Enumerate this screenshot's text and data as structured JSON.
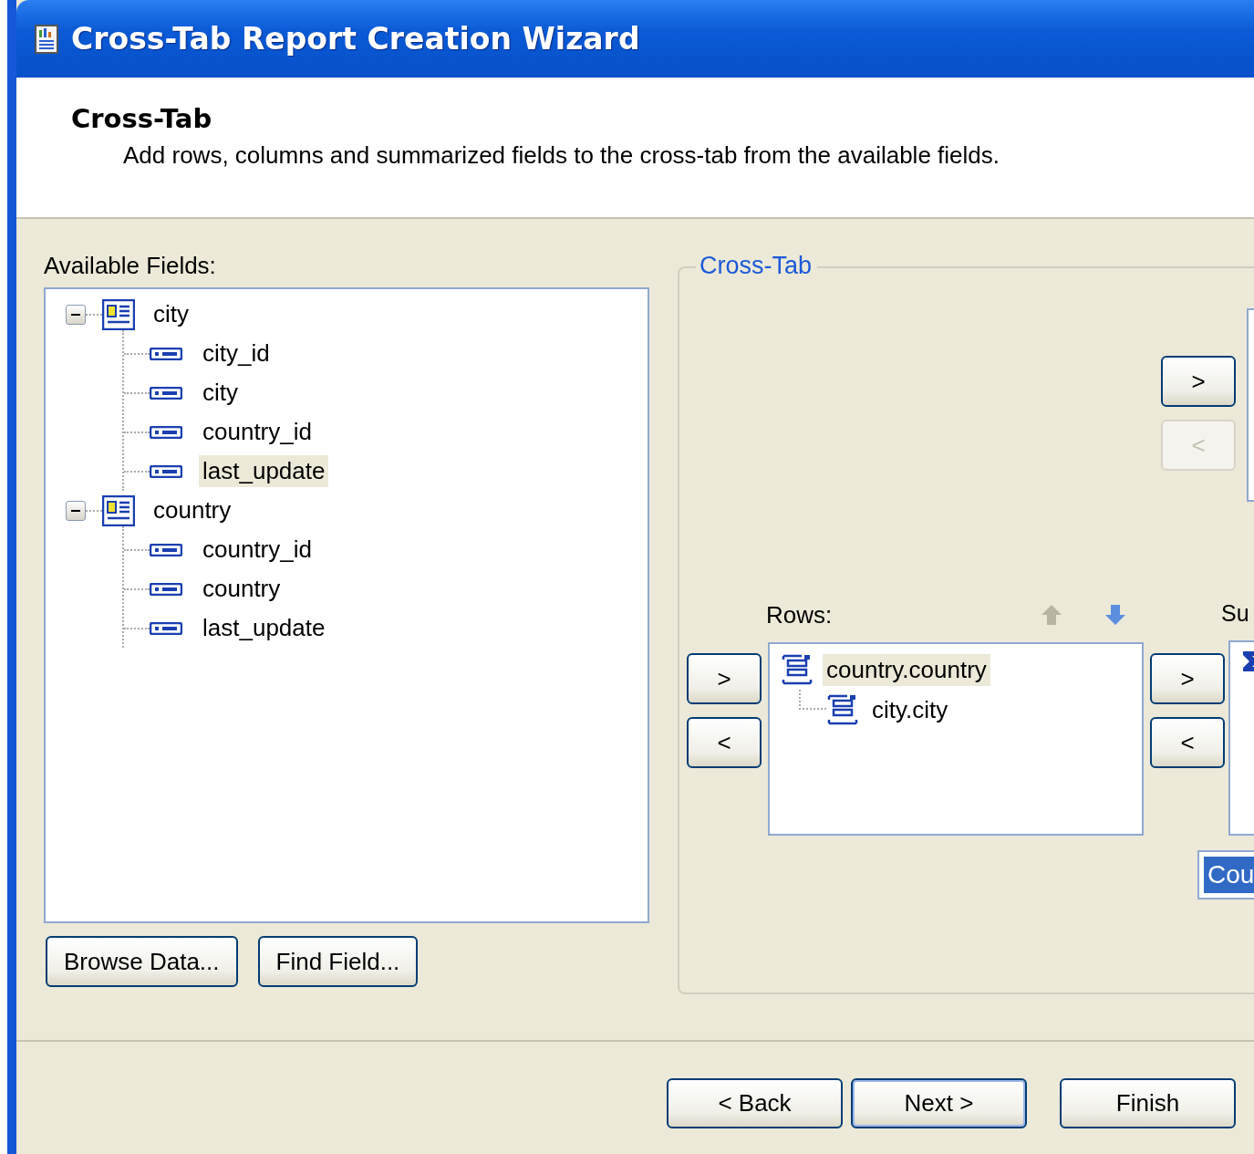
{
  "window": {
    "title": "Cross-Tab Report Creation Wizard"
  },
  "header": {
    "title": "Cross-Tab",
    "description": "Add rows, columns and summarized fields to the cross-tab from the available fields."
  },
  "available_fields": {
    "label": "Available Fields:",
    "tree": [
      {
        "label": "city",
        "kind": "table",
        "expanded": true,
        "selected": false,
        "children": [
          {
            "label": "city_id",
            "kind": "field",
            "selected": false
          },
          {
            "label": "city",
            "kind": "field",
            "selected": false
          },
          {
            "label": "country_id",
            "kind": "field",
            "selected": false
          },
          {
            "label": "last_update",
            "kind": "field",
            "selected": true
          }
        ]
      },
      {
        "label": "country",
        "kind": "table",
        "expanded": true,
        "selected": false,
        "children": [
          {
            "label": "country_id",
            "kind": "field",
            "selected": false
          },
          {
            "label": "country",
            "kind": "field",
            "selected": false
          },
          {
            "label": "last_update",
            "kind": "field",
            "selected": false
          }
        ]
      }
    ]
  },
  "field_buttons": [
    {
      "label": "Browse Data..."
    },
    {
      "label": "Find Field..."
    }
  ],
  "cross_tab": {
    "title": "Cross-Tab",
    "columns": {
      "add_button": {
        "label": ">",
        "disabled": false
      },
      "remove_button": {
        "label": "<",
        "disabled": true
      }
    },
    "rows": {
      "label": "Rows:",
      "move_up_disabled": true,
      "move_down_disabled": false,
      "add_button": {
        "label": ">",
        "disabled": false
      },
      "remove_button": {
        "label": "<",
        "disabled": false
      },
      "items": [
        {
          "label": "country.country",
          "selected": true,
          "children": [
            {
              "label": "city.city",
              "selected": false
            }
          ]
        }
      ]
    },
    "summary": {
      "label": "Su",
      "add_button": {
        "label": ">",
        "disabled": false
      },
      "remove_button": {
        "label": "<",
        "disabled": false
      },
      "function_value": "Cou",
      "function_selected": true
    }
  },
  "footer_buttons": [
    {
      "label": "< Back",
      "default": false
    },
    {
      "label": "Next >",
      "default": true
    },
    {
      "label": "Finish",
      "default": false
    }
  ]
}
